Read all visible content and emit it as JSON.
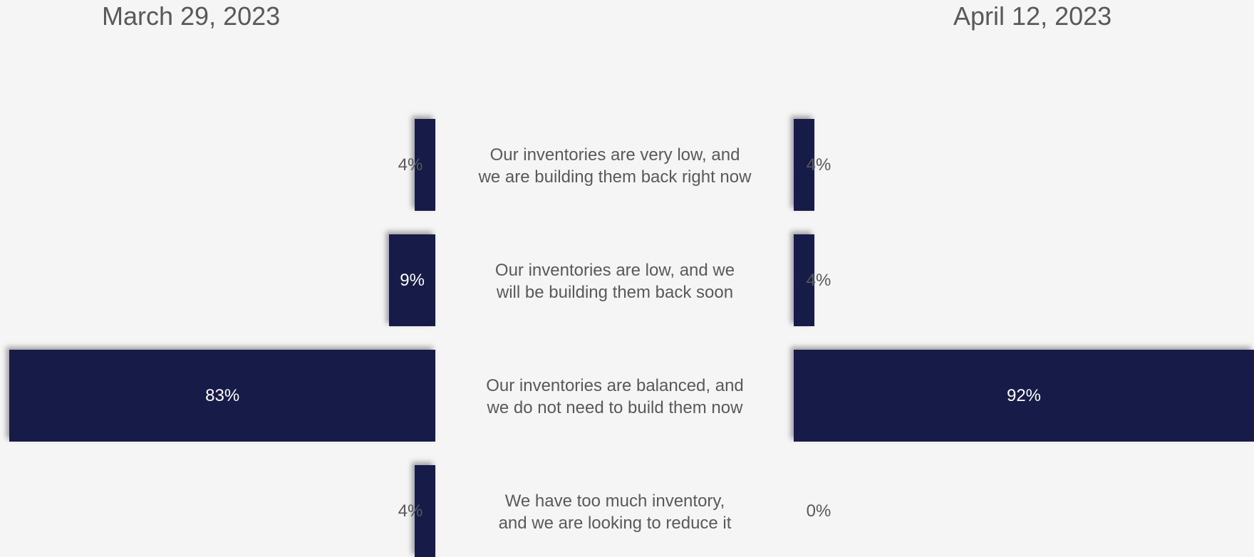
{
  "chart_data": [
    {
      "type": "bar",
      "title": "March 29, 2023",
      "categories": [
        "Our inventories are very low, and we are building them back right now",
        "Our inventories are low, and we will be building them back soon",
        "Our inventories are balanced, and we do not need to build them now",
        "We have too much inventory, and we are looking to reduce it"
      ],
      "values": [
        4,
        9,
        83,
        4
      ],
      "value_labels": [
        "4%",
        "9%",
        "83%",
        "4%"
      ],
      "orientation": "horizontal",
      "direction": "right-to-left"
    },
    {
      "type": "bar",
      "title": "April 12, 2023",
      "categories": [
        "Our inventories are very low, and we are building them back right now",
        "Our inventories are low, and we will be building them back soon",
        "Our inventories are balanced, and we do not need to build them now",
        "We have too much inventory, and we are looking to reduce it"
      ],
      "values": [
        4,
        4,
        92,
        0
      ],
      "value_labels": [
        "4%",
        "4%",
        "92%",
        "0%"
      ],
      "orientation": "horizontal",
      "direction": "left-to-right"
    }
  ],
  "labels": {
    "left_title": "March 29, 2023",
    "right_title": "April 12, 2023",
    "categories": [
      [
        "Our inventories are very low, and",
        "we are building them back right now"
      ],
      [
        "Our inventories are low, and we",
        "will be building them back soon"
      ],
      [
        "Our inventories are balanced, and",
        "we do not need to build them now"
      ],
      [
        "We have too much inventory,",
        "and we are looking to reduce it"
      ]
    ]
  },
  "colors": {
    "bar": "#161c47",
    "label_on_bar": "#ffffff",
    "label_off_bar": "#595959",
    "text": "#595959",
    "background": "#f5f5f5"
  }
}
